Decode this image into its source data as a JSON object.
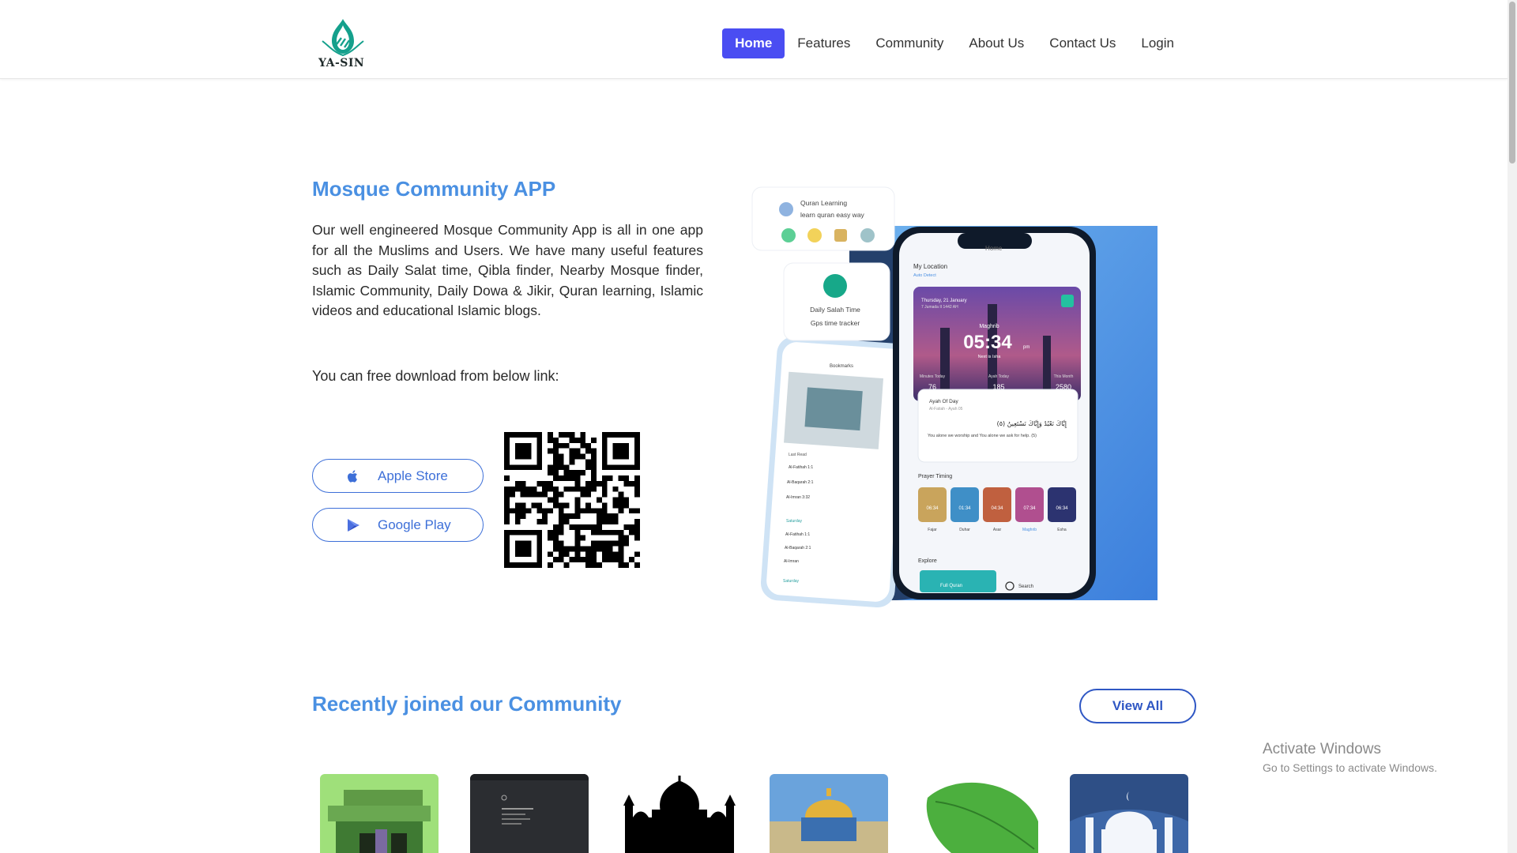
{
  "brand": {
    "name": "YA-SIN"
  },
  "nav": {
    "items": [
      {
        "label": "Home",
        "active": true
      },
      {
        "label": "Features",
        "active": false
      },
      {
        "label": "Community",
        "active": false
      },
      {
        "label": "About Us",
        "active": false
      },
      {
        "label": "Contact Us",
        "active": false
      },
      {
        "label": "Login",
        "active": false
      }
    ]
  },
  "hero": {
    "title": "Mosque Community APP",
    "description": "Our well engineered Mosque Community App is all in one app for all the Muslims and Users. We have many useful features such as Daily Salat time, Qibla finder, Nearby Mosque finder, Islamic Community, Daily Dowa & Jikir, Quran learning, Islamic videos and educational Islamic blogs.",
    "download_text": "You can free download from below link:",
    "apple_label": "Apple Store",
    "google_label": "Google Play"
  },
  "illustration": {
    "card_quran_title": "Quran Learning",
    "card_quran_sub": "learn quran easy way",
    "card_salah_title": "Daily Salah Time",
    "card_salah_sub": "Gps time tracker",
    "phone_home": "Home",
    "location_label": "My Location",
    "location_sub": "Auto Detect",
    "date_text": "Thursday, 21 January",
    "hijri_text": "7 Jumada II 1442 AH",
    "prayer_name": "Maghrib",
    "prayer_time": "05:34",
    "prayer_ampm": "pm",
    "next_label": "Next is Isha",
    "stat1_label": "Minutes Today",
    "stat1_value": "76",
    "stat2_label": "Ayah Today",
    "stat2_value": "185",
    "stat3_label": "This Month",
    "stat3_value": "2580",
    "ayah_title": "Ayah Of Day",
    "ayah_sub": "Al-Fatiah - Ayah 05",
    "ayah_arabic": "إِيَّاكَ نَعْبُدُ وَإِيَّاكَ نَسْتَعِينُ (٥)",
    "ayah_english": "You alone we worship and You alone we ask for help. (5)",
    "prayer_timing_label": "Prayer Timing",
    "prayers": [
      {
        "name": "Fajar",
        "time": "06:34",
        "color": "#c9a45c"
      },
      {
        "name": "Duhar",
        "time": "01:34",
        "color": "#3f8fc7"
      },
      {
        "name": "Asar",
        "time": "04:34",
        "color": "#c0603f"
      },
      {
        "name": "Maghrib",
        "time": "07:34",
        "color": "#b04f8f"
      },
      {
        "name": "Esha",
        "time": "06:34",
        "color": "#2c3370"
      }
    ],
    "explore_label": "Explore",
    "full_quran_label": "Full Quran",
    "search_label": "Search",
    "bookmarks_label": "Bookmarks",
    "last_read_label": "Last Read",
    "surah_items": [
      "Al-Fatihah 1:1",
      "Al-Baqarah 2:1",
      "Al-Imran 3:32"
    ],
    "saved_label": "Saturday",
    "saved_items": [
      "Al-Fatihah 1:1",
      "Al-Baqarah 2:1",
      "Al-Imran"
    ],
    "saved_label2": "Saturday"
  },
  "community": {
    "title": "Recently joined our Community",
    "view_all_label": "View All",
    "members": [
      {
        "icon": "pixel-avatar"
      },
      {
        "icon": "dark-screen-thumbnail"
      },
      {
        "icon": "mosque-silhouette"
      },
      {
        "icon": "dome-of-rock-photo"
      },
      {
        "icon": "green-leaf"
      },
      {
        "icon": "white-mosque-illustration"
      }
    ]
  },
  "watermark": {
    "line1": "Activate Windows",
    "line2": "Go to Settings to activate Windows."
  },
  "colors": {
    "accent": "#4a4df2",
    "heading": "#4a90e2",
    "button_border": "#3d6fd8"
  }
}
